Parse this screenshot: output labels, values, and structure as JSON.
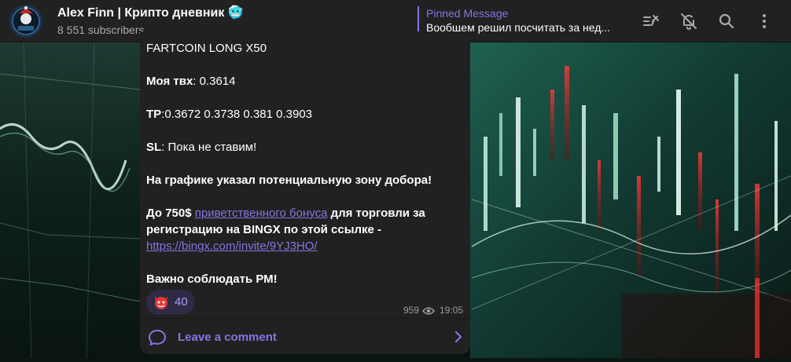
{
  "header": {
    "channel_title": "Alex Finn | Крипто дневник 🥶",
    "subscribers": "8 551 subscribers",
    "avatar_label": "Alex Finn"
  },
  "pinned": {
    "label": "Pinned Message",
    "text": "Вообщем решил посчитать за нед..."
  },
  "icons": {
    "pin_list": "pinned-list-icon",
    "mute": "bell-off-icon",
    "search": "search-icon",
    "more": "more-vertical-icon"
  },
  "message": {
    "line1": "FARTCOIN LONG X50",
    "entry_label": "Моя твх",
    "entry_value": ": 0.3614",
    "tp_label": "TP",
    "tp_value": ":0.3672  0.3738 0.381 0.3903",
    "sl_label": "SL",
    "sl_value": ": Пока не ставим!",
    "zone": "На графике указал потенциальную зону добора!",
    "bonus_prefix": "До 750$ ",
    "bonus_link": "приветственного бонуса",
    "bonus_suffix": " для торговли за",
    "bonus_line2": "регистрацию на BINGX по этой ссылке -",
    "ref_link": "https://bingx.com/invite/9YJ3HO/",
    "rm": "Важно соблюдать РМ!"
  },
  "reaction": {
    "emoji": "devil-face",
    "count": "40"
  },
  "meta": {
    "views": "959",
    "time": "19:05"
  },
  "comments": {
    "label": "Leave a comment"
  },
  "colors": {
    "accent": "#8774e1",
    "header_bg": "#212121",
    "bubble_bg": "#212121"
  }
}
